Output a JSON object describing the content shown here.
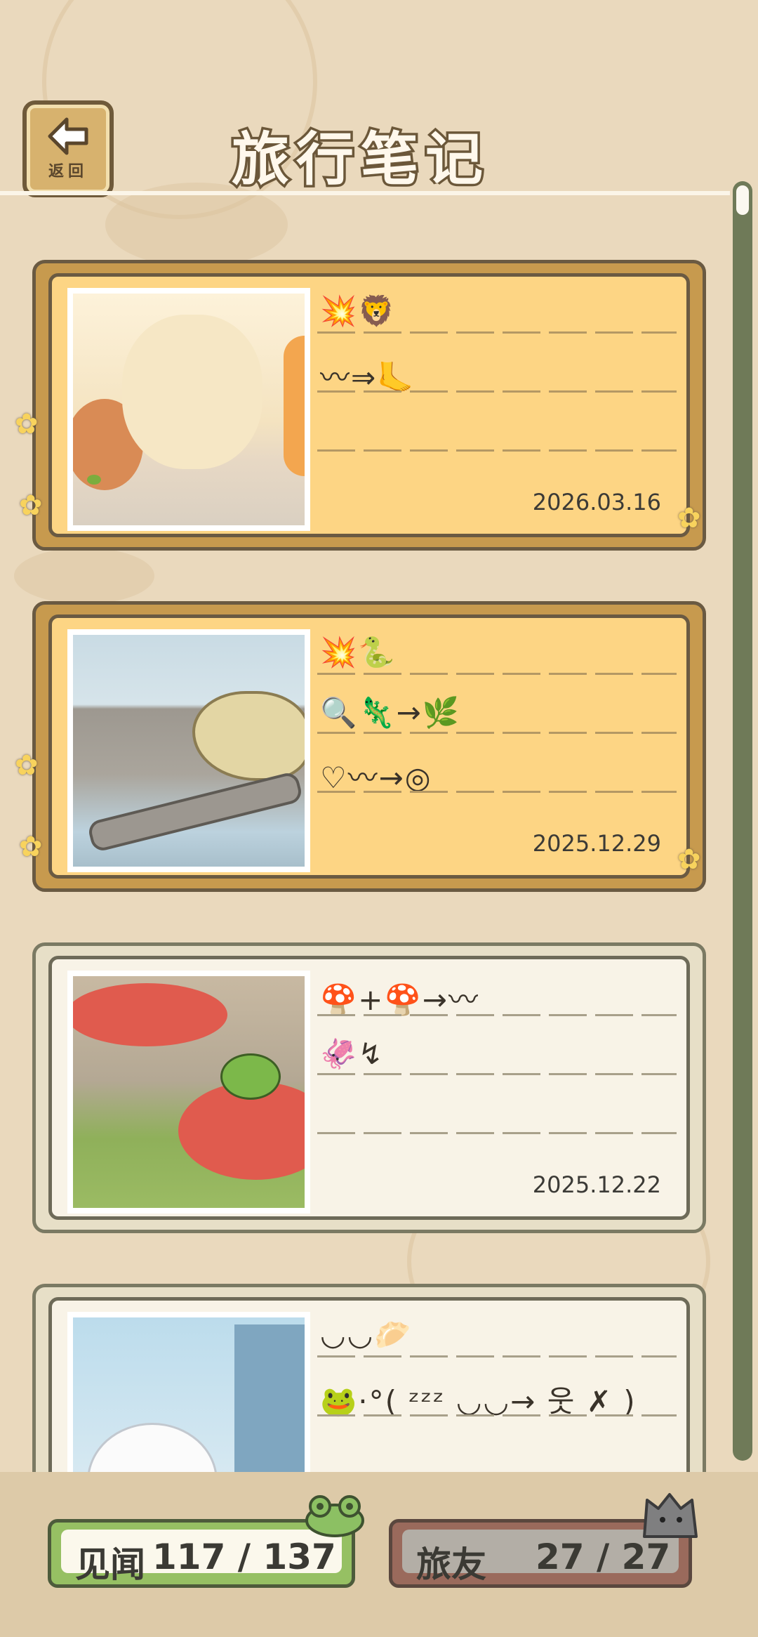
{
  "header": {
    "title": "旅行笔记",
    "back_label": "返回"
  },
  "entries": [
    {
      "date": "2026.03.16",
      "row1": "💥🦁",
      "row2": "〰⇒🦶",
      "row3": ""
    },
    {
      "date": "2025.12.29",
      "row1": "💥🐍",
      "row2": "🔍🦎→🌿",
      "row3": "♡〰→◎"
    },
    {
      "date": "2025.12.22",
      "row1": "🍄+🍄→〰",
      "row2": "🦑↯",
      "row3": ""
    },
    {
      "date": "",
      "row1": "◡◡🥟",
      "row2": "🐸·°( ᶻᶻᶻ ◡◡→ 웃 ✗ )",
      "row3": ""
    }
  ],
  "footer": {
    "knowledge_label": "见闻",
    "knowledge_value": "117 / 137",
    "friends_label": "旅友",
    "friends_value": "27 / 27"
  },
  "colors": {
    "gold_card": "#fdd584",
    "plain_card": "#f8f3e7",
    "green_pill": "#96c063",
    "gray_pill": "#b3aea6"
  },
  "icons": [
    "back-arrow-icon",
    "flower-icon",
    "frog-face-icon",
    "cat-face-icon"
  ]
}
